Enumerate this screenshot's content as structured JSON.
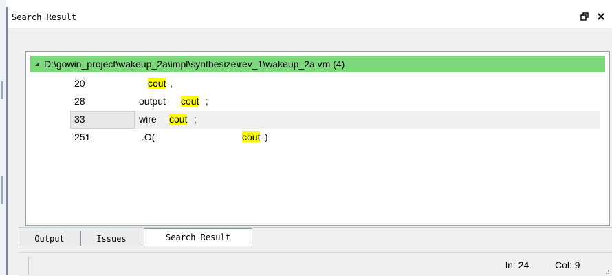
{
  "panel": {
    "title": "Search Result"
  },
  "file": {
    "path": "D:\\gowin_project\\wakeup_2a\\impl\\synthesize\\rev_1\\wakeup_2a.vm (4)"
  },
  "results": [
    {
      "line": "20",
      "pre": "",
      "match": "cout",
      "post": ","
    },
    {
      "line": "28",
      "pre": "output ",
      "match": "cout",
      "post": " ;"
    },
    {
      "line": "33",
      "pre": "wire ",
      "match": "cout",
      "post": " ;"
    },
    {
      "line": "251",
      "pre": ".O(",
      "match": "cout",
      "post": ")"
    }
  ],
  "tabs": [
    "Output",
    "Issues",
    "Search Result"
  ],
  "status": {
    "ln": "ln: 24",
    "col": "Col: 9"
  },
  "colors": {
    "file_row_bg": "#7bd97b",
    "highlight": "#ffff00"
  },
  "icons": {
    "restore": "restore-icon",
    "close": "close-icon",
    "expand": "expanded-triangle-icon"
  }
}
